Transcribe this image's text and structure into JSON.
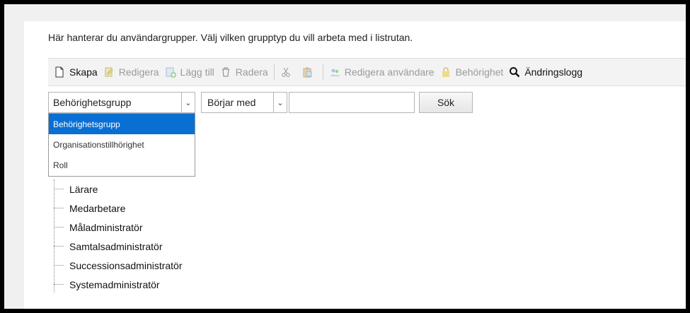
{
  "intro_text": "Här hanterar du användargrupper. Välj vilken grupptyp du vill arbeta med i listrutan.",
  "toolbar": {
    "create": "Skapa",
    "edit": "Redigera",
    "add": "Lägg till",
    "delete": "Radera",
    "edit_users": "Redigera användare",
    "permission": "Behörighet",
    "change_log": "Ändringslogg"
  },
  "filters": {
    "group_type_selected": "Behörighetsgrupp",
    "match_mode_selected": "Börjar med",
    "search_value": "",
    "search_button": "Sök"
  },
  "dropdown_options": [
    "Behörighetsgrupp",
    "Organisationstillhörighet",
    "Roll"
  ],
  "tree_items": [
    "Lärare",
    "Medarbetare",
    "Måladministratör",
    "Samtalsadministratör",
    "Successionsadministratör",
    "Systemadministratör"
  ],
  "colors": {
    "selected_option": "#0a6fd2",
    "toolbar_bg": "#f3f3f3"
  }
}
